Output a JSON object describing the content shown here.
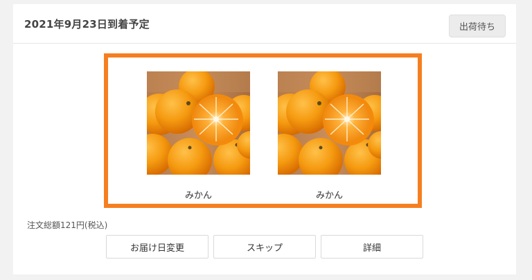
{
  "order": {
    "delivery_date": "2021年9月23日到着予定",
    "status": "出荷待ち",
    "total": "注文総額121円(税込)"
  },
  "products": [
    {
      "name": "みかん",
      "image": "orange-photo"
    },
    {
      "name": "みかん",
      "image": "orange-photo"
    }
  ],
  "actions": {
    "change_date": "お届け日変更",
    "skip": "スキップ",
    "details": "詳細"
  },
  "colors": {
    "highlight_border": "#f57f20",
    "status_bg": "#ececec",
    "page_bg": "#f2f2f2"
  }
}
